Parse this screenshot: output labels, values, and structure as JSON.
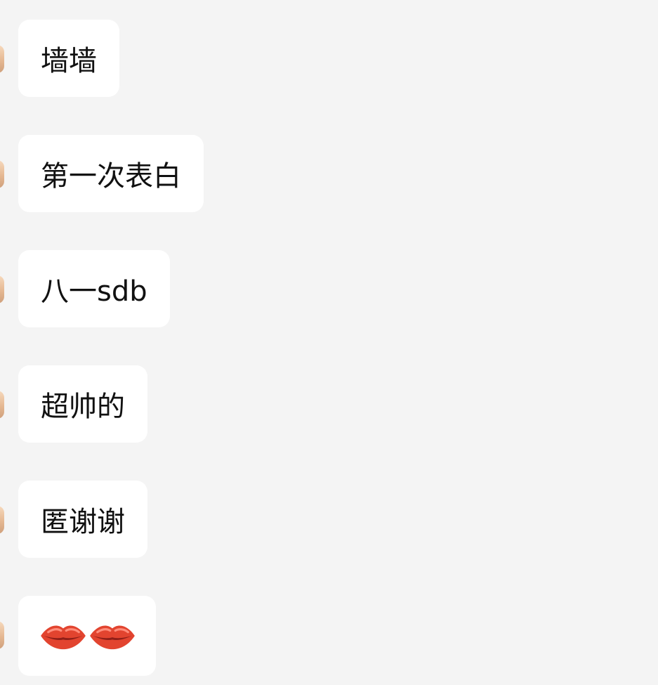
{
  "messages": [
    {
      "text": "墙墙"
    },
    {
      "text": "第一次表白"
    },
    {
      "text": "八一sdb"
    },
    {
      "text": "超帅的"
    },
    {
      "text": "匿谢谢"
    },
    {
      "icons": [
        "lips-icon",
        "lips-icon"
      ]
    }
  ],
  "colors": {
    "background": "#f4f4f4",
    "bubble": "#ffffff",
    "text": "#111111",
    "lips": "#e2442f"
  }
}
